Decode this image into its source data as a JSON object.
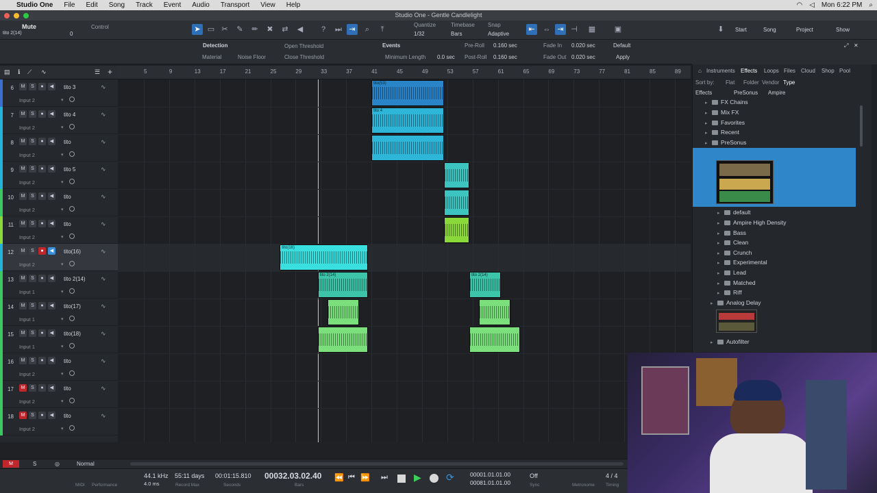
{
  "menubar": {
    "app_name": "Studio One",
    "items": [
      "File",
      "Edit",
      "Song",
      "Track",
      "Event",
      "Audio",
      "Transport",
      "View",
      "Help"
    ],
    "clock": "Mon 6:22 PM"
  },
  "window": {
    "title": "Studio One - Gentle Candlelight"
  },
  "toolbar": {
    "track_name": "Mute",
    "track_sub": "tito 2(14)",
    "control_label": "Control",
    "control_value": "0",
    "quantize_label": "Quantize",
    "quantize_value": "1/32",
    "timebase_label": "Timebase",
    "timebase_value": "Bars",
    "snap_label": "Snap",
    "snap_value": "Adaptive",
    "nav": {
      "start": "Start",
      "song": "Song",
      "project": "Project",
      "show": "Show"
    }
  },
  "infobar": {
    "detection_label": "Detection",
    "material_label": "Material",
    "noise_floor_label": "Noise Floor",
    "open_threshold_label": "Open Threshold",
    "close_threshold_label": "Close Threshold",
    "events_label": "Events",
    "minimum_length_label": "Minimum Length",
    "minimum_length_value": "0.0 sec",
    "pre_roll_label": "Pre-Roll",
    "pre_roll_value": "0.160 sec",
    "post_roll_label": "Post-Roll",
    "post_roll_value": "0.160 sec",
    "fade_in_label": "Fade In",
    "fade_in_value": "0.020 sec",
    "fade_out_label": "Fade Out",
    "fade_out_value": "0.020 sec",
    "default_label": "Default",
    "apply_label": "Apply"
  },
  "ruler": {
    "ticks": [
      "5",
      "9",
      "13",
      "17",
      "21",
      "25",
      "29",
      "33",
      "37",
      "41",
      "45",
      "49",
      "53",
      "57",
      "61",
      "65",
      "69",
      "73",
      "77",
      "81",
      "85",
      "89"
    ]
  },
  "tracks": [
    {
      "num": "6",
      "name": "tito 3",
      "input": "Input 2",
      "color": "#3a6fd0"
    },
    {
      "num": "7",
      "name": "tito 4",
      "input": "Input 2",
      "color": "#24b3d8"
    },
    {
      "num": "8",
      "name": "tito",
      "input": "Input 2",
      "color": "#24b3d8"
    },
    {
      "num": "9",
      "name": "tito 5",
      "input": "Input 2",
      "color": "#24b3d8"
    },
    {
      "num": "10",
      "name": "tito",
      "input": "Input 2",
      "color": "#3cc860"
    },
    {
      "num": "11",
      "name": "tito",
      "input": "Input 2",
      "color": "#8ad83a"
    },
    {
      "num": "12",
      "name": "tito(16)",
      "input": "Input 2",
      "color": "#24b3d8"
    },
    {
      "num": "13",
      "name": "tito 2(14)",
      "input": "Input 1",
      "color": "#3cc860"
    },
    {
      "num": "14",
      "name": "tito(17)",
      "input": "Input 1",
      "color": "#3cc860"
    },
    {
      "num": "15",
      "name": "tito(18)",
      "input": "Input 1",
      "color": "#3cc860"
    },
    {
      "num": "16",
      "name": "tito",
      "input": "Input 2",
      "color": "#3cc860"
    },
    {
      "num": "17",
      "name": "tito",
      "input": "Input 2",
      "color": "#3cc860"
    },
    {
      "num": "18",
      "name": "tito",
      "input": "Input 2",
      "color": "#3cc860"
    }
  ],
  "clips": [
    {
      "name": "tito(53)",
      "row": 0,
      "start": 41,
      "len": 11.5,
      "color": "#2a85c8",
      "h": 0.95
    },
    {
      "name": "tito 4",
      "row": 1,
      "start": 41,
      "len": 11.5,
      "color": "#2db6d8",
      "h": 0.95
    },
    {
      "name": "",
      "row": 2,
      "start": 41,
      "len": 11.5,
      "color": "#2db6d8",
      "h": 0.95
    },
    {
      "name": "",
      "row": 3,
      "start": 52.5,
      "len": 4,
      "color": "#3cc5c0",
      "h": 0.95
    },
    {
      "name": "",
      "row": 4,
      "start": 52.5,
      "len": 4,
      "color": "#3cc5c0",
      "h": 0.95
    },
    {
      "name": "",
      "row": 5,
      "start": 52.5,
      "len": 4,
      "color": "#8ad83a",
      "h": 0.95
    },
    {
      "name": "tito(16)",
      "row": 6,
      "start": 26.5,
      "len": 14,
      "color": "#3ae0e0",
      "h": 0.95
    },
    {
      "name": "tito 2(14)",
      "row": 7,
      "start": 32.5,
      "len": 8,
      "color": "#3cc5a8",
      "h": 0.95
    },
    {
      "name": "tito 2(14)",
      "row": 7,
      "start": 56.5,
      "len": 5,
      "color": "#3cc5a8",
      "h": 0.95
    },
    {
      "name": "",
      "row": 8,
      "start": 34,
      "len": 5,
      "color": "#7be07b",
      "h": 0.95
    },
    {
      "name": "",
      "row": 8,
      "start": 58,
      "len": 5,
      "color": "#7be07b",
      "h": 0.95
    },
    {
      "name": "",
      "row": 9,
      "start": 32.5,
      "len": 8,
      "color": "#7be07b",
      "h": 0.95
    },
    {
      "name": "",
      "row": 9,
      "start": 56.5,
      "len": 8,
      "color": "#7be07b",
      "h": 0.95
    }
  ],
  "bottom": {
    "mode": "Normal"
  },
  "transport": {
    "sample_rate": "44.1 kHz",
    "latency": "4.0 ms",
    "record_max_value": "55:11 days",
    "record_max_label": "Record Max",
    "seconds_value": "00:01:15.810",
    "seconds_label": "Seconds",
    "bars_value": "00032.03.02.40",
    "bars_label": "Bars",
    "loop_start": "00001.01.01.00",
    "loop_end": "00081.01.01.00",
    "sync_value": "Off",
    "sync_label": "Sync",
    "metronome_label": "Metronome",
    "timing_value": "4 / 4",
    "timing_label": "Timing",
    "midi_label": "MIDI",
    "performance_label": "Performance"
  },
  "browser": {
    "tabs": [
      "Instruments",
      "Effects",
      "Loops",
      "Files",
      "Cloud",
      "Shop",
      "Pool"
    ],
    "sort_by": "Sort by:",
    "sort_options": [
      "Flat",
      "Folder",
      "Vendor",
      "Type"
    ],
    "path": [
      "Effects",
      "PreSonus",
      "Ampire"
    ],
    "items": [
      {
        "label": "FX Chains",
        "level": 1
      },
      {
        "label": "Mix FX",
        "level": 1
      },
      {
        "label": "Favorites",
        "level": 1
      },
      {
        "label": "Recent",
        "level": 1
      },
      {
        "label": "PreSonus",
        "level": 1
      },
      {
        "label": "Ampire",
        "level": 2
      },
      {
        "label": "default",
        "level": 3
      },
      {
        "label": "Ampire High Density",
        "level": 3
      },
      {
        "label": "Bass",
        "level": 3
      },
      {
        "label": "Clean",
        "level": 3
      },
      {
        "label": "Crunch",
        "level": 3
      },
      {
        "label": "Experimental",
        "level": 3
      },
      {
        "label": "Lead",
        "level": 3
      },
      {
        "label": "Matched",
        "level": 3
      },
      {
        "label": "Riff",
        "level": 3
      },
      {
        "label": "Analog Delay",
        "level": 2
      },
      {
        "label": "Autofilter",
        "level": 2
      }
    ]
  }
}
